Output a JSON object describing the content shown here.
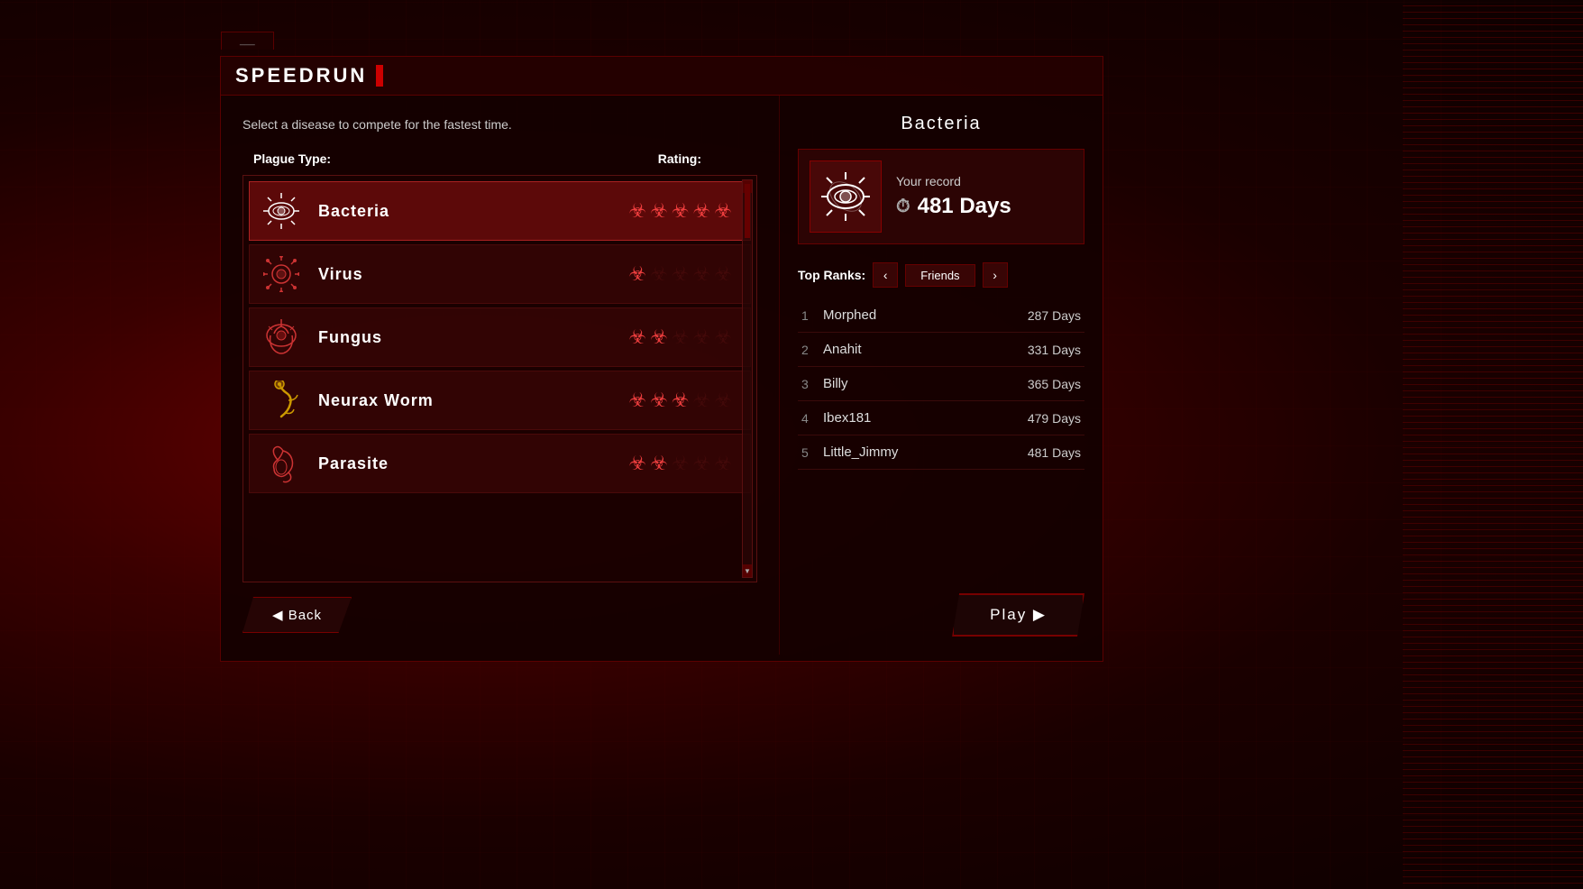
{
  "background": {
    "color": "#1a0000"
  },
  "window": {
    "tab_label": "___",
    "title": "SPEEDRUN",
    "title_accent": true
  },
  "left_panel": {
    "instruction": "Select a disease to compete for the fastest time.",
    "table_header": {
      "plague_type_label": "Plague Type:",
      "rating_label": "Rating:"
    },
    "diseases": [
      {
        "id": "bacteria",
        "name": "Bacteria",
        "icon": "🦠",
        "selected": true,
        "rating": [
          true,
          true,
          true,
          true,
          true
        ]
      },
      {
        "id": "virus",
        "name": "Virus",
        "icon": "✳",
        "selected": false,
        "rating": [
          true,
          false,
          false,
          false,
          false
        ]
      },
      {
        "id": "fungus",
        "name": "Fungus",
        "icon": "🌿",
        "selected": false,
        "rating": [
          true,
          true,
          false,
          false,
          false
        ]
      },
      {
        "id": "neurax_worm",
        "name": "Neurax Worm",
        "icon": "🪱",
        "selected": false,
        "rating": [
          true,
          true,
          true,
          false,
          false
        ]
      },
      {
        "id": "parasite",
        "name": "Parasite",
        "icon": "🐛",
        "selected": false,
        "rating": [
          true,
          true,
          false,
          false,
          false
        ]
      }
    ],
    "back_button": "◀ Back"
  },
  "right_panel": {
    "selected_disease_title": "Bacteria",
    "record": {
      "label": "Your record",
      "days": "481 Days",
      "clock_symbol": "⏱"
    },
    "top_ranks": {
      "label": "Top Ranks:",
      "prev_btn": "‹",
      "filter_btn": "Friends",
      "next_btn": "›",
      "rows": [
        {
          "rank": "1",
          "name": "Morphed",
          "days": "287 Days"
        },
        {
          "rank": "2",
          "name": "Anahit",
          "days": "331 Days"
        },
        {
          "rank": "3",
          "name": "Billy",
          "days": "365 Days"
        },
        {
          "rank": "4",
          "name": "Ibex181",
          "days": "479 Days"
        },
        {
          "rank": "5",
          "name": "Little_Jimmy",
          "days": "481 Days"
        }
      ]
    },
    "play_button": "Play ▶"
  },
  "biohazard_symbol": "☣"
}
